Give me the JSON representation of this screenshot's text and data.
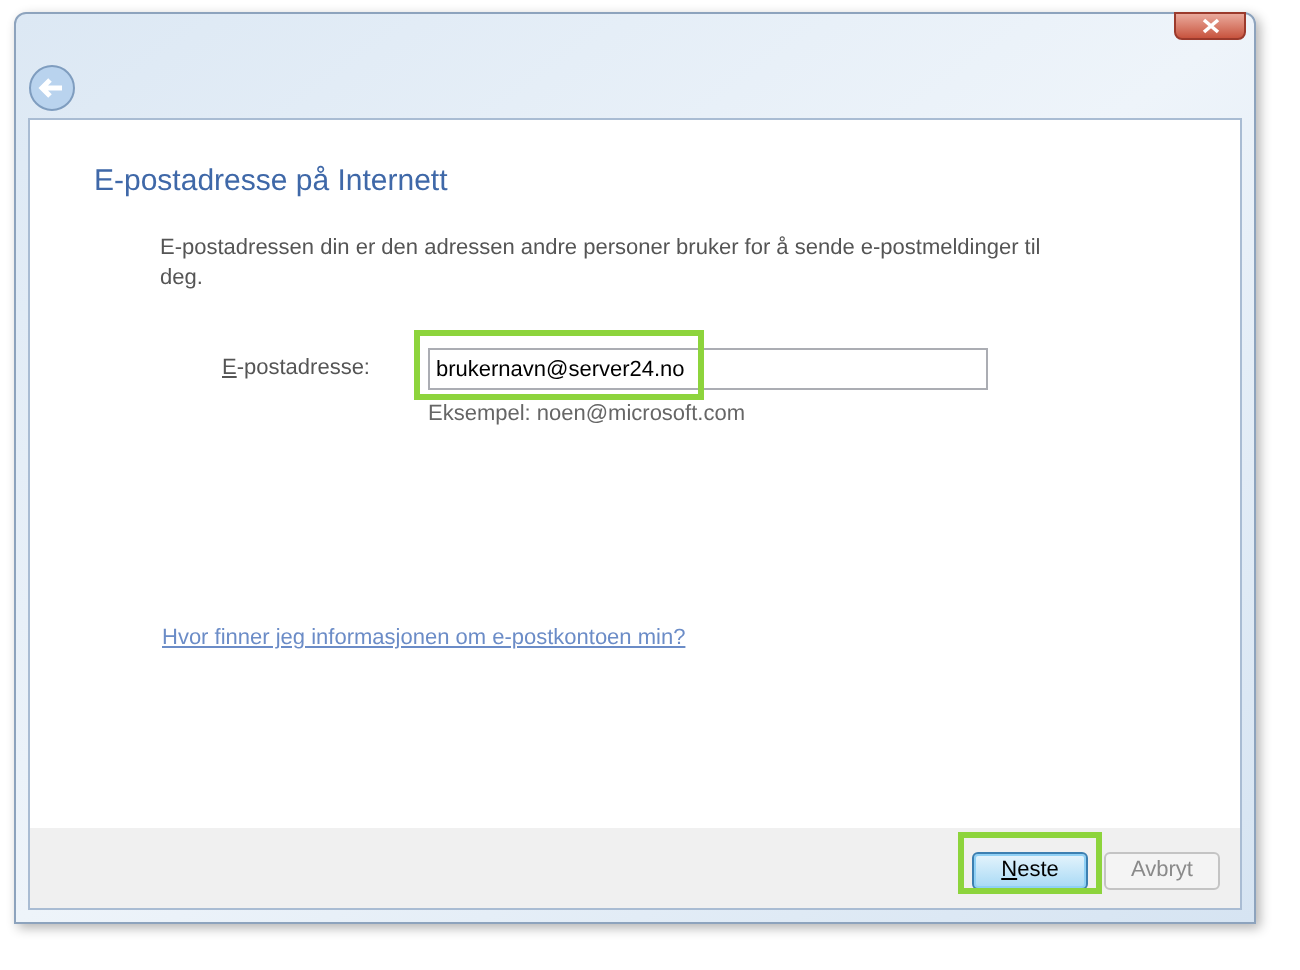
{
  "heading": "E-postadresse på Internett",
  "description": "E-postadressen din er den adressen andre personer bruker for å sende e-postmeldinger til deg.",
  "email_field": {
    "label_accel": "E",
    "label_rest": "-postadresse:",
    "value": "brukernavn@server24.no",
    "highlighted": true
  },
  "example": "Eksempel: noen@microsoft.com",
  "help_link": "Hvor finner jeg informasjonen om e-postkontoen min?",
  "buttons": [
    {
      "accel": "N",
      "rest": "este",
      "default": true,
      "disabled": false,
      "highlighted": true
    },
    {
      "rest": "Avbryt",
      "default": false,
      "disabled": true,
      "highlighted": false
    }
  ]
}
